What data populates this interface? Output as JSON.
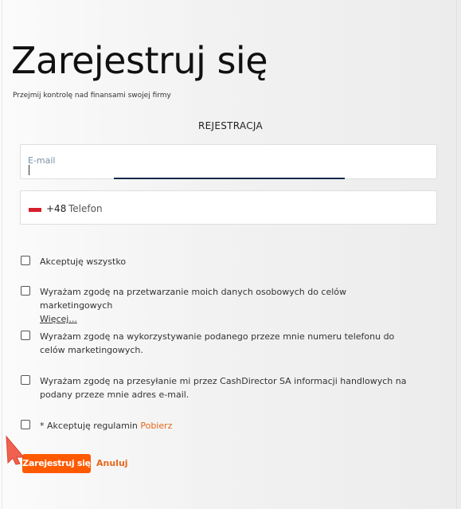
{
  "page": {
    "title": "Zarejestruj się",
    "subtitle": "Przejmij kontrolę nad finansami swojej firmy",
    "section_title": "REJESTRACJA"
  },
  "form": {
    "email": {
      "placeholder": "E-mail",
      "value": ""
    },
    "phone": {
      "country_prefix": "+48",
      "placeholder": "Telefon",
      "flag": "poland-flag-icon"
    }
  },
  "consents": [
    {
      "text": "Akceptuję wszystko",
      "checked": false
    },
    {
      "text": "Wyrażam zgodę na przetwarzanie moich danych osobowych do celów marketingowych",
      "link": "Więcej...",
      "checked": false
    },
    {
      "text": "Wyrażam zgodę na wykorzystywanie podanego przeze mnie numeru telefonu do celów marketingowych.",
      "checked": false
    },
    {
      "text": "Wyrażam zgodę na przesyłanie mi przez CashDirector SA informacji handlowych na podany przeze mnie adres e-mail.",
      "checked": false
    },
    {
      "text": "* Akceptuję regulamin",
      "link": "Pobierz",
      "checked": false
    }
  ],
  "actions": {
    "register_label": "Zarejestruj się",
    "cancel_label": "Anuluj"
  },
  "colors": {
    "accent": "#ff5a00",
    "link": "#e8671a",
    "email_focus_underline": "#0f2a4a",
    "cursor_arrow": "#f0614f"
  },
  "icons": {
    "cursor": "mouse-pointer-arrow-icon"
  }
}
